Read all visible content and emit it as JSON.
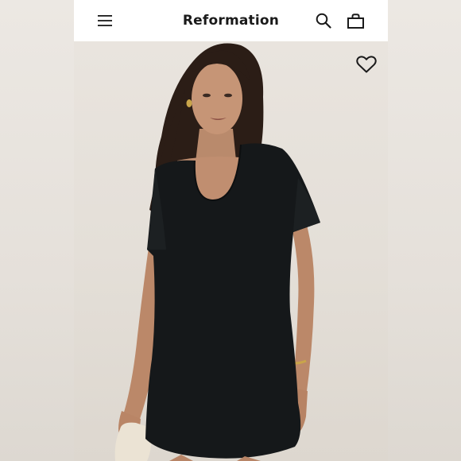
{
  "header": {
    "brand": "Reformation",
    "menu_icon": "hamburger-menu-icon",
    "search_icon": "search-icon",
    "bag_icon": "shopping-bag-icon"
  },
  "product_image": {
    "description_icon": "product-photo",
    "favorite_icon": "heart-outline-icon"
  },
  "colors": {
    "header_bg": "#ffffff",
    "brand_text": "#1a1a1a",
    "dress": "#15181a",
    "backdrop": "#e6e1db"
  }
}
